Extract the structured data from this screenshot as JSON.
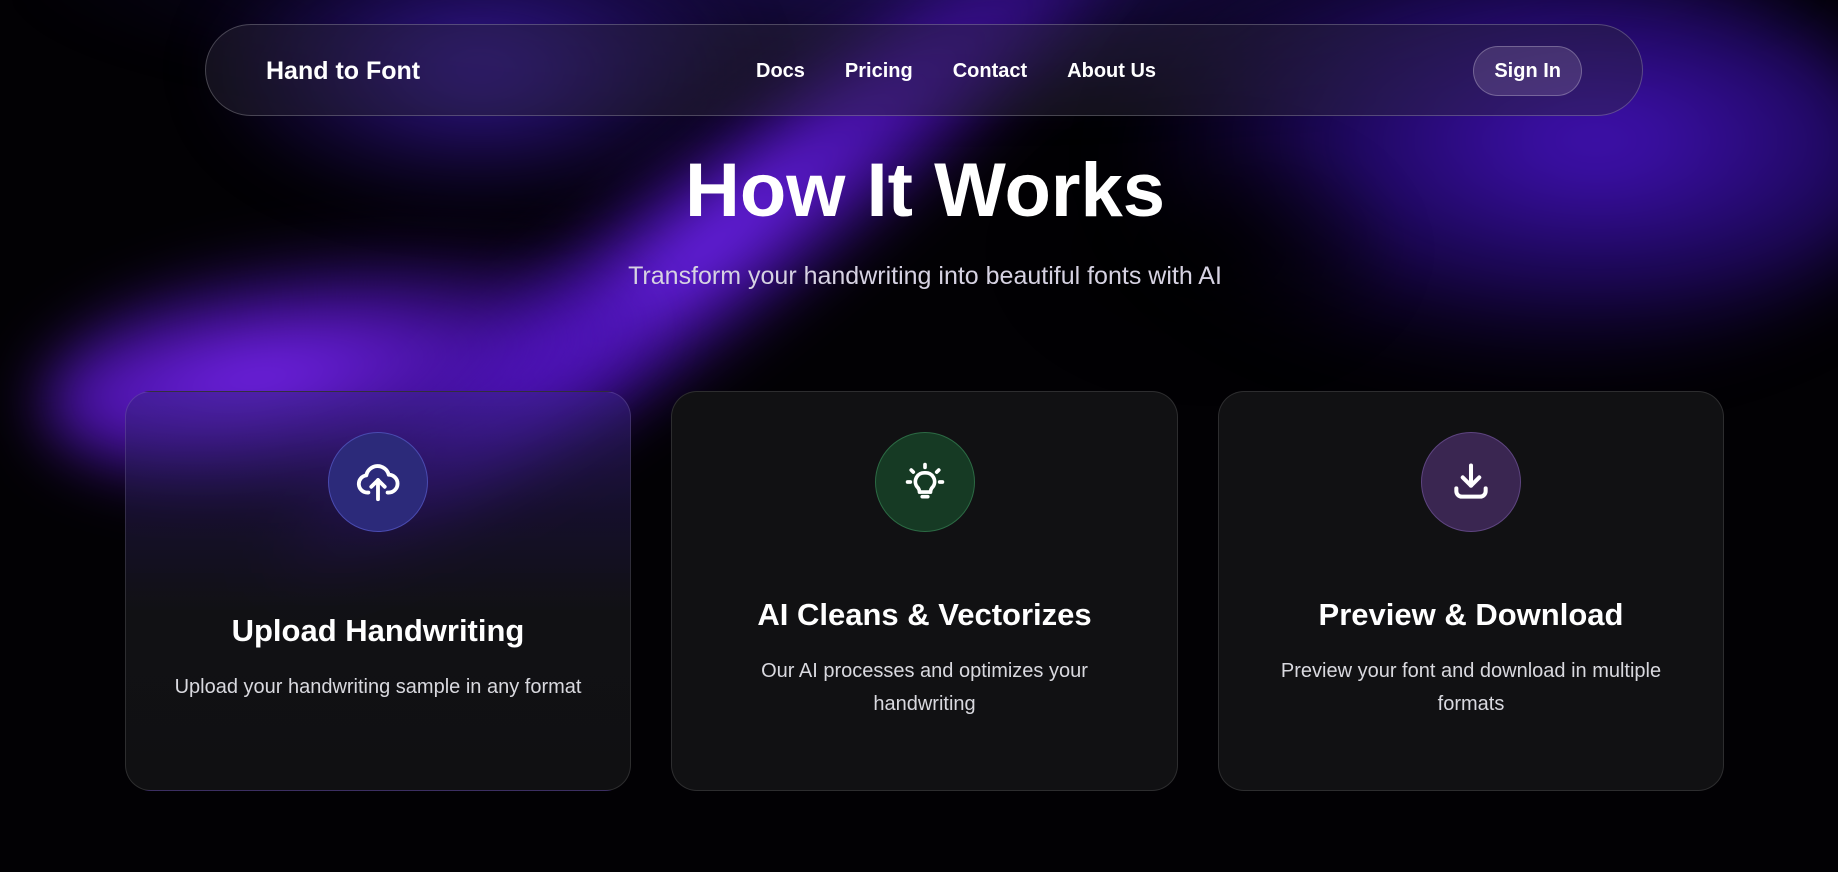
{
  "nav": {
    "brand": "Hand to Font",
    "links": [
      "Docs",
      "Pricing",
      "Contact",
      "About Us"
    ],
    "signin_label": "Sign In"
  },
  "hero": {
    "title": "How It Works",
    "subtitle": "Transform your handwriting into beautiful fonts with AI"
  },
  "cards": [
    {
      "icon": "cloud-upload-icon",
      "title": "Upload Handwriting",
      "description": "Upload your handwriting sample in any format"
    },
    {
      "icon": "lightbulb-icon",
      "title": "AI Cleans & Vectorizes",
      "description": "Our AI processes and optimizes your handwriting"
    },
    {
      "icon": "download-icon",
      "title": "Preview & Download",
      "description": "Preview your font and download in multiple formats"
    }
  ],
  "colors": {
    "background": "#020104",
    "accent_purple": "#7a28ff",
    "icon_blue": "#2c2a7a",
    "icon_green": "#163a24",
    "icon_purple": "#3a2651"
  }
}
